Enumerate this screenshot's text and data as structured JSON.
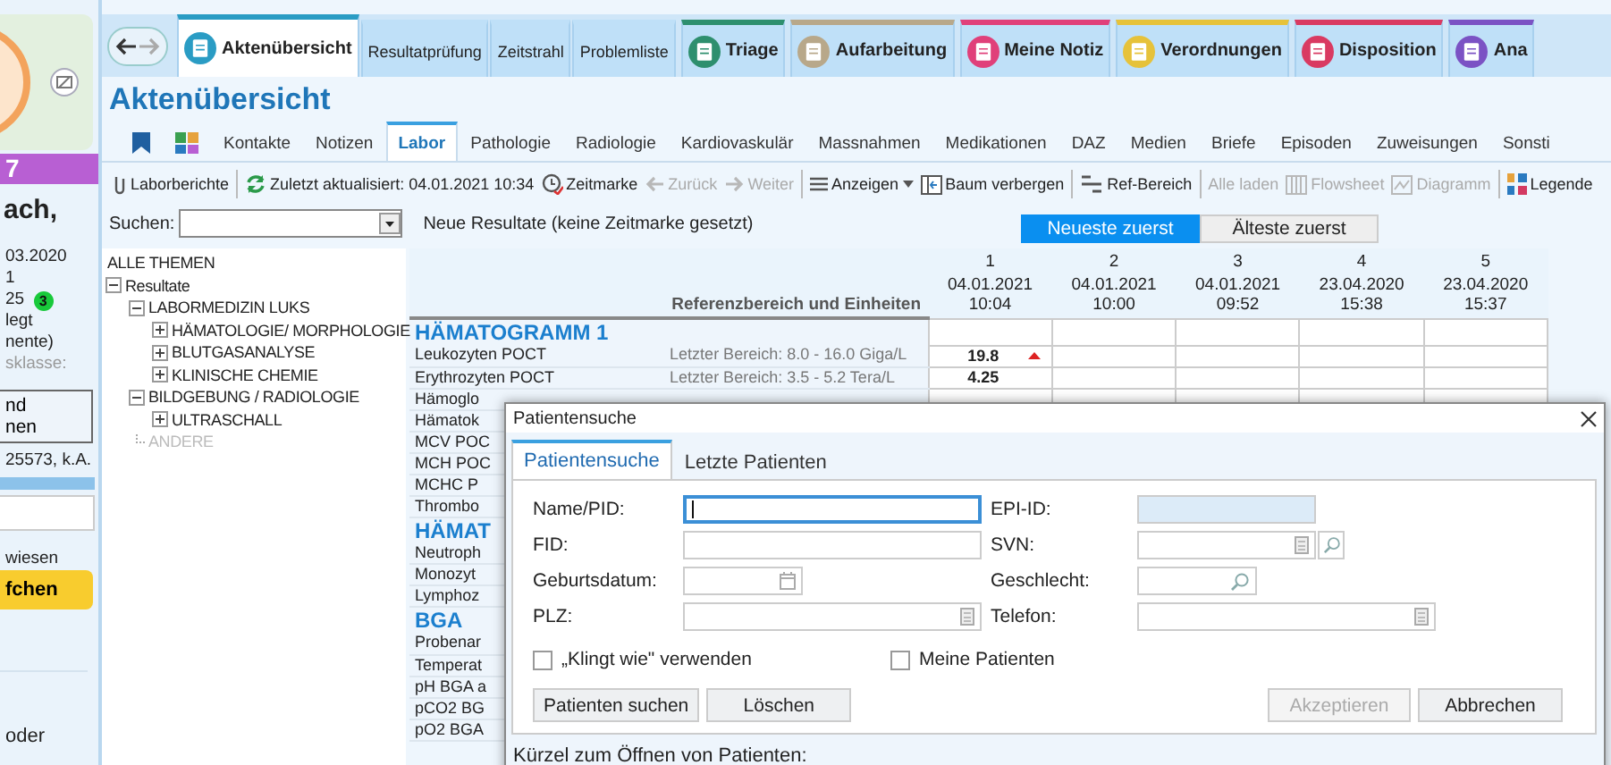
{
  "sidebar": {
    "header_number": "7",
    "name": "ach,",
    "lines": [
      "03.2020",
      "1"
    ],
    "count": "25",
    "count_badge": "3",
    "status_lines": [
      "legt",
      "nente)"
    ],
    "class_label": "sklasse:",
    "box_button_lines": [
      "nd",
      "nen"
    ],
    "id_text": "25573, k.A.",
    "note": "wiesen",
    "action_button": "fchen",
    "footer": "oder"
  },
  "main_tabs": [
    {
      "label": "Aktenübersicht",
      "selected": true,
      "kind": "icon",
      "color": "#2a9cc4"
    },
    {
      "label": "Resultatprüfung",
      "selected": false,
      "kind": "plain"
    },
    {
      "label": "Zeitstrahl",
      "selected": false,
      "kind": "plain"
    },
    {
      "label": "Problemliste",
      "selected": false,
      "kind": "plain"
    },
    {
      "label": "Triage",
      "selected": false,
      "kind": "icon",
      "color": "#2e8f6e"
    },
    {
      "label": "Aufarbeitung",
      "selected": false,
      "kind": "icon",
      "color": "#b8a88a"
    },
    {
      "label": "Meine Notiz",
      "selected": false,
      "kind": "icon",
      "color": "#e0407a"
    },
    {
      "label": "Verordnungen",
      "selected": false,
      "kind": "icon",
      "color": "#e6c23a"
    },
    {
      "label": "Disposition",
      "selected": false,
      "kind": "icon",
      "color": "#d93a62"
    },
    {
      "label": "Ana",
      "selected": false,
      "kind": "icon",
      "color": "#7b52c4"
    }
  ],
  "page_title": "Aktenübersicht",
  "sub_tabs": [
    {
      "kind": "bookmark",
      "selected": false
    },
    {
      "kind": "grid",
      "selected": false
    },
    {
      "kind": "text",
      "label": "Kontakte",
      "selected": false
    },
    {
      "kind": "text",
      "label": "Notizen",
      "selected": false
    },
    {
      "kind": "text",
      "label": "Labor",
      "selected": true
    },
    {
      "kind": "text",
      "label": "Pathologie",
      "selected": false
    },
    {
      "kind": "text",
      "label": "Radiologie",
      "selected": false
    },
    {
      "kind": "text",
      "label": "Kardiovaskulär",
      "selected": false
    },
    {
      "kind": "text",
      "label": "Massnahmen",
      "selected": false
    },
    {
      "kind": "text",
      "label": "Medikationen",
      "selected": false
    },
    {
      "kind": "text",
      "label": "DAZ",
      "selected": false
    },
    {
      "kind": "text",
      "label": "Medien",
      "selected": false
    },
    {
      "kind": "text",
      "label": "Briefe",
      "selected": false
    },
    {
      "kind": "text",
      "label": "Episoden",
      "selected": false
    },
    {
      "kind": "text",
      "label": "Zuweisungen",
      "selected": false
    },
    {
      "kind": "text",
      "label": "Sonsti",
      "selected": false
    }
  ],
  "toolbar": [
    {
      "kind": "reports",
      "label": "Laborberichte",
      "disabled": false
    },
    {
      "kind": "separator"
    },
    {
      "kind": "refresh",
      "label": "Zuletzt aktualisiert: 04.01.2021 10:34",
      "disabled": false
    },
    {
      "kind": "timemark",
      "label": "Zeitmarke",
      "disabled": false
    },
    {
      "kind": "back",
      "label": "Zurück",
      "disabled": true
    },
    {
      "kind": "forward",
      "label": "Weiter",
      "disabled": true
    },
    {
      "kind": "separator"
    },
    {
      "kind": "view",
      "label": "Anzeigen",
      "disabled": false
    },
    {
      "kind": "tree",
      "label": "Baum verbergen",
      "disabled": false
    },
    {
      "kind": "separator"
    },
    {
      "kind": "range",
      "label": "Ref-Bereich",
      "disabled": false
    },
    {
      "kind": "separator"
    },
    {
      "kind": "load",
      "label": "Alle laden",
      "disabled": true
    },
    {
      "kind": "flowsheet",
      "label": "Flowsheet",
      "disabled": true
    },
    {
      "kind": "diagram",
      "label": "Diagramm",
      "disabled": true
    },
    {
      "kind": "separator"
    },
    {
      "kind": "legend",
      "label": "Legende",
      "disabled": false
    }
  ],
  "search": {
    "label": "Suchen:"
  },
  "status_text": "Neue Resultate (keine Zeitmarke gesetzt)",
  "sort_options": [
    {
      "label": "Neueste zuerst",
      "selected": true
    },
    {
      "label": "Älteste zuerst",
      "selected": false
    }
  ],
  "tree": {
    "title": "ALLE THEMEN",
    "items": [
      {
        "label": "Resultate",
        "expanded": true,
        "children": [
          {
            "label": "LABORMEDIZIN LUKS",
            "expanded": true,
            "disabled": false,
            "children": [
              {
                "label": "HÄMATOLOGIE/ MORPHOLOGIE",
                "expanded": false
              },
              {
                "label": "BLUTGASANALYSE",
                "expanded": false
              },
              {
                "label": "KLINISCHE CHEMIE",
                "expanded": false
              }
            ]
          },
          {
            "label": "BILDGEBUNG / RADIOLOGIE",
            "expanded": true,
            "disabled": false,
            "children": [
              {
                "label": "ULTRASCHALL",
                "expanded": false
              }
            ]
          },
          {
            "label": "ANDERE",
            "disabled": true
          }
        ]
      }
    ]
  },
  "table": {
    "reference_header": "Referenzbereich und Einheiten",
    "columns": [
      {
        "number": "1",
        "date": "04.01.2021",
        "time": "10:04"
      },
      {
        "number": "2",
        "date": "04.01.2021",
        "time": "10:00"
      },
      {
        "number": "3",
        "date": "04.01.2021",
        "time": "09:52"
      },
      {
        "number": "4",
        "date": "23.04.2020",
        "time": "15:38"
      },
      {
        "number": "5",
        "date": "23.04.2020",
        "time": "15:37"
      }
    ],
    "rows": [
      {
        "kind": "group",
        "label": "HÄMATOGRAMM 1"
      },
      {
        "kind": "result",
        "label": "Leukozyten POCT",
        "reference": "Letzter Bereich: 8.0 - 16.0 Giga/L",
        "values": [
          "19.8"
        ],
        "high": true
      },
      {
        "kind": "result",
        "label": "Erythrozyten POCT",
        "reference": "Letzter Bereich: 3.5 - 5.2 Tera/L",
        "values": [
          "4.25"
        ]
      },
      {
        "kind": "result",
        "label": "Hämoglo"
      },
      {
        "kind": "result",
        "label": "Hämatok"
      },
      {
        "kind": "result",
        "label": "MCV POC"
      },
      {
        "kind": "result",
        "label": "MCH POC"
      },
      {
        "kind": "result",
        "label": "MCHC P"
      },
      {
        "kind": "result",
        "label": "Thrombo"
      },
      {
        "kind": "group",
        "label": "HÄMAT"
      },
      {
        "kind": "result",
        "label": "Neutroph"
      },
      {
        "kind": "result",
        "label": "Monozyt"
      },
      {
        "kind": "result",
        "label": "Lymphoz"
      },
      {
        "kind": "group",
        "label": "BGA"
      },
      {
        "kind": "result",
        "label": "Probenar"
      },
      {
        "kind": "result",
        "label": "Temperat"
      },
      {
        "kind": "result",
        "label": "pH BGA a"
      },
      {
        "kind": "result",
        "label": "pCO2 BG"
      },
      {
        "kind": "result",
        "label": "pO2 BGA"
      }
    ]
  },
  "dialog": {
    "title": "Patientensuche",
    "tabs": [
      {
        "label": "Patientensuche",
        "selected": true
      },
      {
        "label": "Letzte Patienten",
        "selected": false
      }
    ],
    "fields": [
      {
        "label": "Name/PID:",
        "kind": "text",
        "disabled": false,
        "focused": true
      },
      {
        "label": "EPI-ID:",
        "kind": "id",
        "disabled": true,
        "focused": false
      },
      {
        "label": "FID:",
        "kind": "text",
        "disabled": false,
        "focused": false
      },
      {
        "label": "SVN:",
        "kind": "calc-search",
        "disabled": false,
        "focused": false
      },
      {
        "label": "Geburtsdatum:",
        "kind": "date",
        "disabled": false,
        "focused": false
      },
      {
        "label": "Geschlecht:",
        "kind": "search",
        "disabled": false,
        "focused": false
      },
      {
        "label": "PLZ:",
        "kind": "calc",
        "disabled": false,
        "focused": false
      },
      {
        "label": "Telefon:",
        "kind": "calc",
        "disabled": false,
        "focused": false
      }
    ],
    "checkboxes": [
      {
        "label": "„Klingt wie\" verwenden",
        "checked": false
      },
      {
        "label": "Meine Patienten",
        "checked": false
      }
    ],
    "buttons": [
      {
        "label": "Patienten suchen",
        "disabled": false
      },
      {
        "label": "Löschen",
        "disabled": false
      },
      {
        "label": "Akzeptieren",
        "disabled": true
      },
      {
        "label": "Abbrechen",
        "disabled": false
      }
    ],
    "footer": "Kürzel zum Öffnen von Patienten:"
  }
}
